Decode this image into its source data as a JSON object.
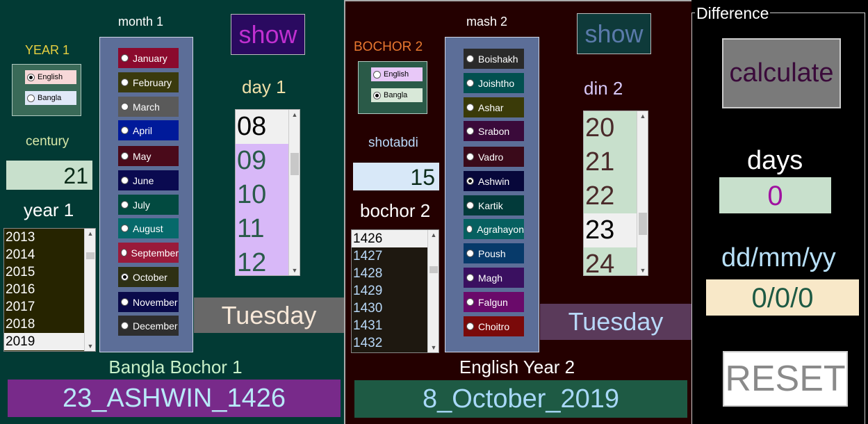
{
  "panel1": {
    "year_label": "YEAR 1",
    "calendar_options": [
      "English",
      "Bangla"
    ],
    "month_label": "month 1",
    "show_button": "show",
    "day_label": "day 1",
    "century_label": "century",
    "century_value": "21",
    "year_list_label": "year 1",
    "years": [
      "2013",
      "2014",
      "2015",
      "2016",
      "2017",
      "2018",
      "2019"
    ],
    "selected_year": "2019",
    "months": [
      "January",
      "February",
      "March",
      "April",
      "May",
      "June",
      "July",
      "August",
      "September",
      "October",
      "November",
      "December"
    ],
    "selected_month": "October",
    "days": [
      "08",
      "09",
      "10",
      "11",
      "12"
    ],
    "selected_day": "08",
    "weekday": "Tuesday",
    "result_label": "Bangla Bochor 1",
    "result_value": "23_ASHWIN_1426"
  },
  "panel2": {
    "year_label": "BOCHOR 2",
    "calendar_options": [
      "English",
      "Bangla"
    ],
    "month_label": "mash 2",
    "show_button": "show",
    "day_label": "din 2",
    "century_label": "shotabdi",
    "century_value": "15",
    "year_list_label": "bochor 2",
    "years": [
      "1426",
      "1427",
      "1428",
      "1429",
      "1430",
      "1431",
      "1432"
    ],
    "selected_year": "1426",
    "months": [
      "Boishakh",
      "Joishtho",
      "Ashar",
      "Srabon",
      "Vadro",
      "Ashwin",
      "Kartik",
      "Agrahayon",
      "Poush",
      "Magh",
      "Falgun",
      "Choitro"
    ],
    "selected_month": "Ashwin",
    "days": [
      "20",
      "21",
      "22",
      "23",
      "24"
    ],
    "selected_day": "23",
    "weekday": "Tuesday",
    "result_label": "English Year 2",
    "result_value": "8_October_2019"
  },
  "difference": {
    "title": "Difference",
    "calculate_button": "calculate",
    "days_label": "days",
    "days_value": "0",
    "date_label": "dd/mm/yy",
    "date_value": "0/0/0",
    "reset_button": "RESET"
  },
  "colors": {
    "panel1_bg": "#023a34",
    "panel2_bg": "#240000",
    "months1": [
      "#8b0a2d",
      "#3a3a0e",
      "#5a5a5a",
      "#001a9a",
      "#4a0a1a",
      "#0a0a50",
      "#024a40",
      "#06696a",
      "#9a1a3a",
      "#2e3014",
      "#0a0a4a",
      "#2e2e2e"
    ],
    "months2": [
      "#2a2a2a",
      "#025050",
      "#3a3a08",
      "#3a0a3a",
      "#3a0a1a",
      "#07073a",
      "#023a3a",
      "#066060",
      "#073a6a",
      "#3a1060",
      "#6a0a6a",
      "#7a0a0a"
    ]
  }
}
